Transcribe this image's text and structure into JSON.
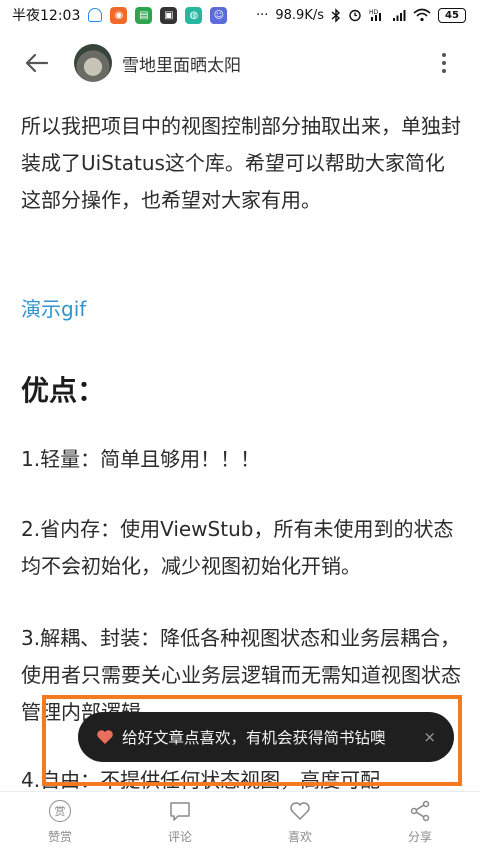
{
  "status_bar": {
    "time": "半夜12:03",
    "network_speed": "98.9K/s",
    "dots": "···",
    "battery": "45",
    "app_icons": [
      "headset-icon",
      "weibo-icon",
      "green-app-icon",
      "dark-app-icon",
      "teal-app-icon",
      "purple-app-icon"
    ],
    "system_icons": [
      "bluetooth-icon",
      "alarm-icon",
      "hd-signal-icon",
      "signal-bars-icon",
      "wifi-icon",
      "battery-icon"
    ]
  },
  "header": {
    "author_name": "雪地里面晒太阳",
    "back_icon": "arrow-left-icon",
    "more_icon": "more-vertical-icon"
  },
  "article": {
    "intro": "所以我把项目中的视图控制部分抽取出来，单独封装成了UiStatus这个库。希望可以帮助大家简化这部分操作，也希望对大家有用。",
    "demo_link": "演示gif",
    "heading": "优点：",
    "points": [
      "1.轻量：简单且够用！！！",
      "2.省内存：使用ViewStub，所有未使用到的状态均不会初始化，减少视图初始化开销。",
      "3.解耦、封装：降低各种视图状态和业务层耦合，使用者只需要关心业务层逻辑而无需知道视图状态管理内部逻辑。",
      "4.自由：不提供任何状态视图，高度可配"
    ]
  },
  "toast": {
    "text": "给好文章点喜欢，有机会获得简书钻噢",
    "close": "×",
    "heart_color": "#ea6f5a",
    "highlight_color": "#f5791f"
  },
  "bottom_bar": {
    "reward_glyph": "赏",
    "tabs": [
      {
        "label": "赞赏",
        "icon": "reward-icon"
      },
      {
        "label": "评论",
        "icon": "comment-icon"
      },
      {
        "label": "喜欢",
        "icon": "heart-icon"
      },
      {
        "label": "分享",
        "icon": "share-icon"
      }
    ]
  }
}
